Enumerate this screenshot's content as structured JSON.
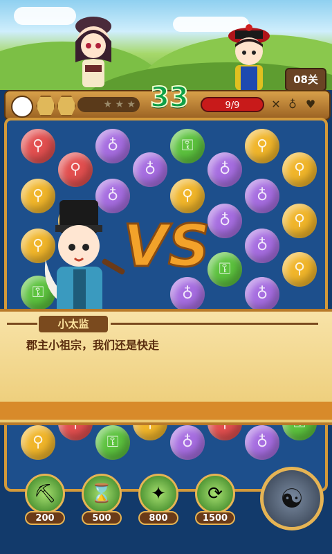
{
  "hud": {
    "moves_left": "33",
    "boss_hp": "9/9",
    "level": "08关"
  },
  "dialog": {
    "speaker": "小太监",
    "text": "郡主小祖宗，我们还是快走"
  },
  "powerups": [
    {
      "name": "shovel",
      "price": "200"
    },
    {
      "name": "hourglass",
      "price": "500"
    },
    {
      "name": "firecracker",
      "price": "800"
    },
    {
      "name": "refresh",
      "price": "1500"
    }
  ],
  "vs_text": "VS",
  "colors": {
    "moves_green": "#0fa048",
    "hp_red": "#c81a1a",
    "board_blue": "#1d4f8c",
    "gold_border": "#d49a3a"
  }
}
